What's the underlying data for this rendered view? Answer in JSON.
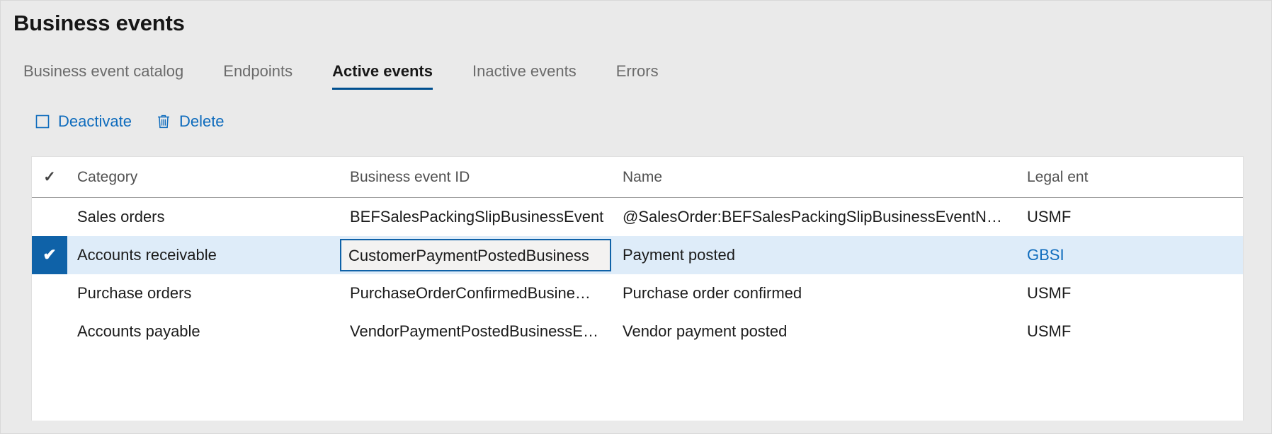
{
  "page": {
    "title": "Business events"
  },
  "tabs": [
    {
      "label": "Business event catalog",
      "selected": false
    },
    {
      "label": "Endpoints",
      "selected": false
    },
    {
      "label": "Active events",
      "selected": true
    },
    {
      "label": "Inactive events",
      "selected": false
    },
    {
      "label": "Errors",
      "selected": false
    }
  ],
  "toolbar": {
    "deactivate_label": "Deactivate",
    "deactivate_icon": "checkbox-empty-icon",
    "delete_label": "Delete",
    "delete_icon": "trash-icon"
  },
  "grid": {
    "select_all_icon": "checkmark-icon",
    "columns": [
      {
        "key": "check",
        "label": ""
      },
      {
        "key": "category",
        "label": "Category"
      },
      {
        "key": "business_event_id",
        "label": "Business event ID"
      },
      {
        "key": "name",
        "label": "Name"
      },
      {
        "key": "legal_entity",
        "label": "Legal ent"
      }
    ],
    "rows": [
      {
        "selected": false,
        "category": "Sales orders",
        "business_event_id": "BEFSalesPackingSlipBusinessEvent",
        "name": "@SalesOrder:BEFSalesPackingSlipBusinessEventN…",
        "legal_entity": "USMF",
        "legal_entity_is_link": false
      },
      {
        "selected": true,
        "category": "Accounts receivable",
        "business_event_id": "CustomerPaymentPostedBusiness",
        "name": "Payment posted",
        "legal_entity": "GBSI",
        "legal_entity_is_link": true
      },
      {
        "selected": false,
        "category": "Purchase orders",
        "business_event_id": "PurchaseOrderConfirmedBusine…",
        "name": "Purchase order confirmed",
        "legal_entity": "USMF",
        "legal_entity_is_link": false
      },
      {
        "selected": false,
        "category": "Accounts payable",
        "business_event_id": "VendorPaymentPostedBusinessE…",
        "name": "Vendor payment posted",
        "legal_entity": "USMF",
        "legal_entity_is_link": false
      }
    ],
    "selected_row_checkmark": "✔"
  },
  "colors": {
    "accent": "#0f6cbd",
    "selection_blue": "#0f62a8",
    "selected_row_bg": "#deecf9",
    "tab_underline": "#004f8f",
    "page_bg": "#eaeaea"
  }
}
